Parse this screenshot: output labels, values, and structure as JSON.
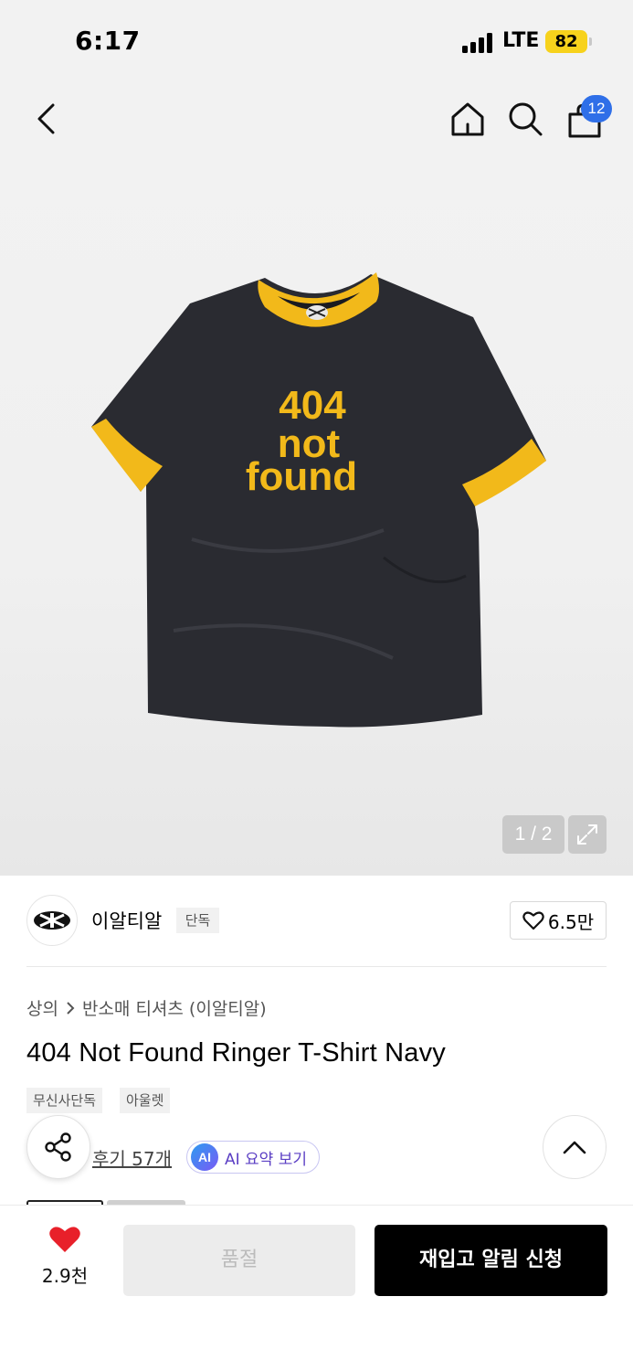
{
  "status_bar": {
    "time": "6:17",
    "network": "LTE",
    "battery": "82"
  },
  "header": {
    "cart_count": "12"
  },
  "gallery": {
    "counter": "1 / 2",
    "shirt_print": [
      "404",
      "not",
      "found"
    ]
  },
  "brand": {
    "name": "이알티알",
    "exclusive_tag": "단독",
    "likes": "6.5만"
  },
  "breadcrumb": {
    "category": "상의",
    "subcategory": "반소매 티셔츠 (이알티알)"
  },
  "product": {
    "title": "404 Not Found Ringer T-Shirt Navy",
    "tags": [
      "무신사단독",
      "아울렛"
    ]
  },
  "reviews": {
    "label": "후기 57개",
    "ai_badge": "AI",
    "ai_label": "AI 요약 보기"
  },
  "bottom_bar": {
    "wish_count": "2.9천",
    "soldout_label": "품절",
    "restock_label": "재입고 알림 신청"
  },
  "colors": {
    "accent_blue": "#2f6fe8",
    "wish_red": "#e8202a",
    "shirt_navy": "#2a2b31",
    "ringer_yellow": "#f2b91a",
    "ai_purple": "#5b3fc4"
  },
  "icons": [
    "back-icon",
    "home-icon",
    "search-icon",
    "cart-icon",
    "expand-icon",
    "heart-outline-icon",
    "chevron-right-icon",
    "share-icon",
    "chevron-up-icon",
    "heart-filled-icon"
  ]
}
